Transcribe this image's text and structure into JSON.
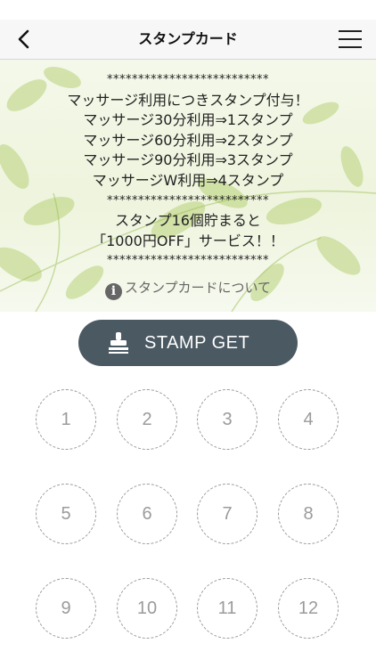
{
  "nav": {
    "title": "スタンプカード",
    "back_icon": "chevron-left-icon",
    "menu_icon": "hamburger-menu-icon"
  },
  "banner": {
    "lines": [
      "**************************",
      "マッサージ利用につきスタンプ付与！",
      "マッサージ30分利用⇒1スタンプ",
      "マッサージ60分利用⇒2スタンプ",
      "マッサージ90分利用⇒3スタンプ",
      "マッサージW利用⇒4スタンプ",
      "**************************",
      "スタンプ16個貯まると",
      "「1000円OFF」サービス！！",
      "**************************"
    ],
    "info_icon": "i",
    "info_label": "スタンプカードについて"
  },
  "stamp_button": {
    "label": "STAMP GET",
    "icon": "stamp-icon"
  },
  "slots": [
    "1",
    "2",
    "3",
    "4",
    "5",
    "6",
    "7",
    "8",
    "9",
    "10",
    "11",
    "12"
  ],
  "colors": {
    "button_bg": "#4b5963",
    "slot_border": "#9a9a9a",
    "nav_bg": "#f7f7f7"
  }
}
